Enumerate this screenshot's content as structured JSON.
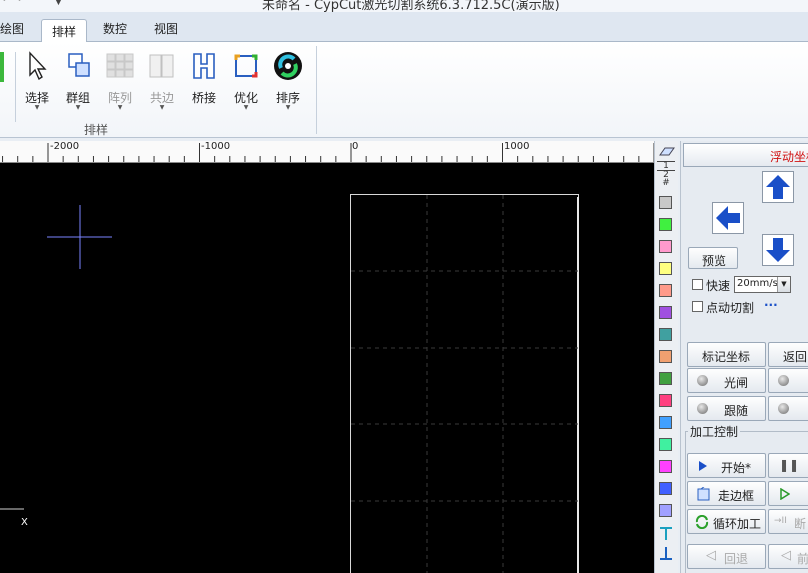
{
  "window": {
    "title": "未命名 - CypCut激光切割系统6.3.712.5C(演示版)"
  },
  "tabs": [
    {
      "label": "绘图",
      "active": false
    },
    {
      "label": "排样",
      "active": true
    },
    {
      "label": "数控",
      "active": false
    },
    {
      "label": "视图",
      "active": false
    }
  ],
  "ribbon": {
    "buttons": [
      {
        "label": "选择",
        "icon": "select-arrow-icon",
        "enabled": true
      },
      {
        "label": "群组",
        "icon": "group-icon",
        "enabled": true
      },
      {
        "label": "阵列",
        "icon": "array-icon",
        "enabled": false
      },
      {
        "label": "共边",
        "icon": "common-edge-icon",
        "enabled": false
      },
      {
        "label": "桥接",
        "icon": "bridge-icon",
        "enabled": true
      },
      {
        "label": "优化",
        "icon": "optimize-icon",
        "enabled": true
      },
      {
        "label": "排序",
        "icon": "sort-icon",
        "enabled": true
      }
    ],
    "group_label": "排样"
  },
  "ruler": {
    "labels": [
      "-2000",
      "-1000",
      "0",
      "1000"
    ]
  },
  "canvas": {
    "axis_label": "X"
  },
  "palette": {
    "top_labels": [
      "1",
      "2",
      "#"
    ],
    "colors": [
      "#c8c8c8",
      "#40f040",
      "#ff99cc",
      "#ffff80",
      "#ff9a8a",
      "#a050e0",
      "#40a0a0",
      "#f0a070",
      "#40a040",
      "#ff4080",
      "#40a0ff",
      "#40f0a0",
      "#ff40ff",
      "#4060ff",
      "#a0a0ff"
    ]
  },
  "right_panel": {
    "float_coord": "浮动坐标",
    "preview": "预览",
    "fast_label": "快速",
    "speed": "20mm/s",
    "jog_cut_label": "点动切割",
    "more": "···",
    "mark_coord": "标记坐标",
    "return_label": "返回",
    "shutter": "光闸",
    "follow": "跟随",
    "process_control": "加工控制",
    "start": "开始*",
    "frame": "走边框",
    "loop": "循环加工",
    "breakpoint": "断",
    "back": "回退",
    "forward": "前",
    "colors": {
      "title_red": "#d01010",
      "arrow_blue": "#1a4fc8"
    }
  }
}
